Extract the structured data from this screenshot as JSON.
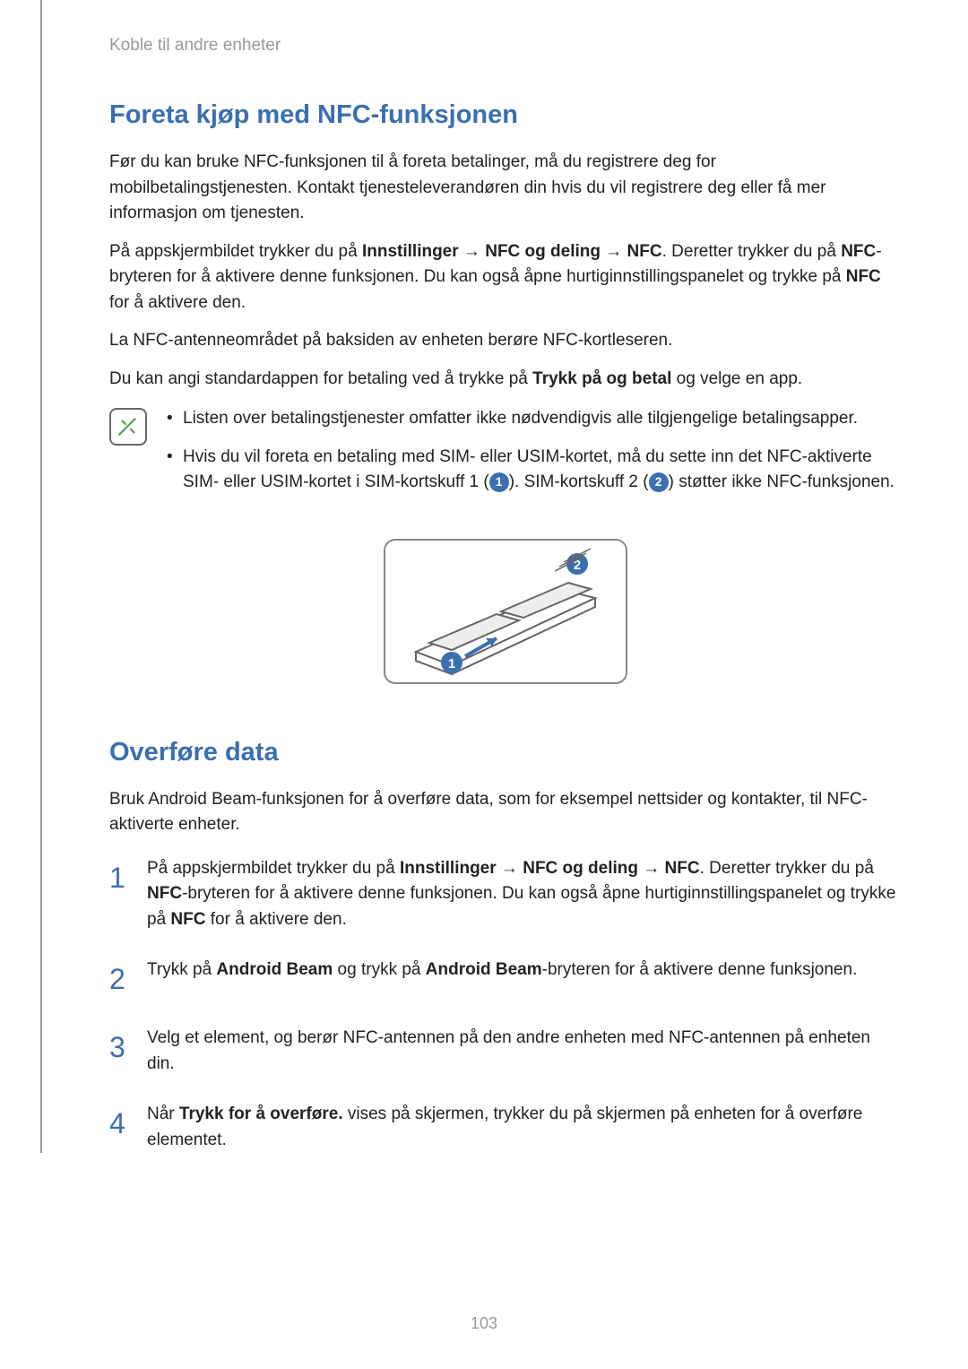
{
  "breadcrumb": "Koble til andre enheter",
  "section1": {
    "heading": "Foreta kjøp med NFC-funksjonen",
    "p1": "Før du kan bruke NFC-funksjonen til å foreta betalinger, må du registrere deg for mobilbetalingstjenesten. Kontakt tjenesteleverandøren din hvis du vil registrere deg eller få mer informasjon om tjenesten.",
    "p2a": "På appskjermbildet trykker du på ",
    "p2b": "Innstillinger",
    "p2c": " → ",
    "p2d": "NFC og deling",
    "p2e": " → ",
    "p2f": "NFC",
    "p2g": ". Deretter trykker du på ",
    "p2h": "NFC",
    "p2i": "-bryteren for å aktivere denne funksjonen. Du kan også åpne hurtiginnstillingspanelet og trykke på ",
    "p2j": "NFC",
    "p2k": " for å aktivere den.",
    "p3": "La NFC-antenneområdet på baksiden av enheten berøre NFC-kortleseren.",
    "p4a": "Du kan angi standardappen for betaling ved å trykke på ",
    "p4b": "Trykk på og betal",
    "p4c": " og velge en app.",
    "note1": "Listen over betalingstjenester omfatter ikke nødvendigvis alle tilgjengelige betalingsapper.",
    "note2a": "Hvis du vil foreta en betaling med SIM- eller USIM-kortet, må du sette inn det NFC-aktiverte SIM- eller USIM-kortet i SIM-kortskuff 1 (",
    "note2b": "). SIM-kortskuff 2 (",
    "note2c": ") støtter ikke NFC-funksjonen.",
    "circle1": "1",
    "circle2": "2"
  },
  "section2": {
    "heading": "Overføre data",
    "p1": "Bruk Android Beam-funksjonen for å overføre data, som for eksempel nettsider og kontakter, til NFC-aktiverte enheter.",
    "step1a": "På appskjermbildet trykker du på ",
    "step1b": "Innstillinger",
    "step1c": " → ",
    "step1d": "NFC og deling",
    "step1e": " → ",
    "step1f": "NFC",
    "step1g": ". Deretter trykker du på ",
    "step1h": "NFC",
    "step1i": "-bryteren for å aktivere denne funksjonen. Du kan også åpne hurtiginnstillingspanelet og trykke på ",
    "step1j": "NFC",
    "step1k": " for å aktivere den.",
    "step2a": "Trykk på ",
    "step2b": "Android Beam",
    "step2c": " og trykk på ",
    "step2d": "Android Beam",
    "step2e": "-bryteren for å aktivere denne funksjonen.",
    "step3": "Velg et element, og berør NFC-antennen på den andre enheten med NFC-antennen på enheten din.",
    "step4a": "Når ",
    "step4b": "Trykk for å overføre.",
    "step4c": " vises på skjermen, trykker du på skjermen på enheten for å overføre elementet.",
    "n1": "1",
    "n2": "2",
    "n3": "3",
    "n4": "4"
  },
  "pageNumber": "103"
}
